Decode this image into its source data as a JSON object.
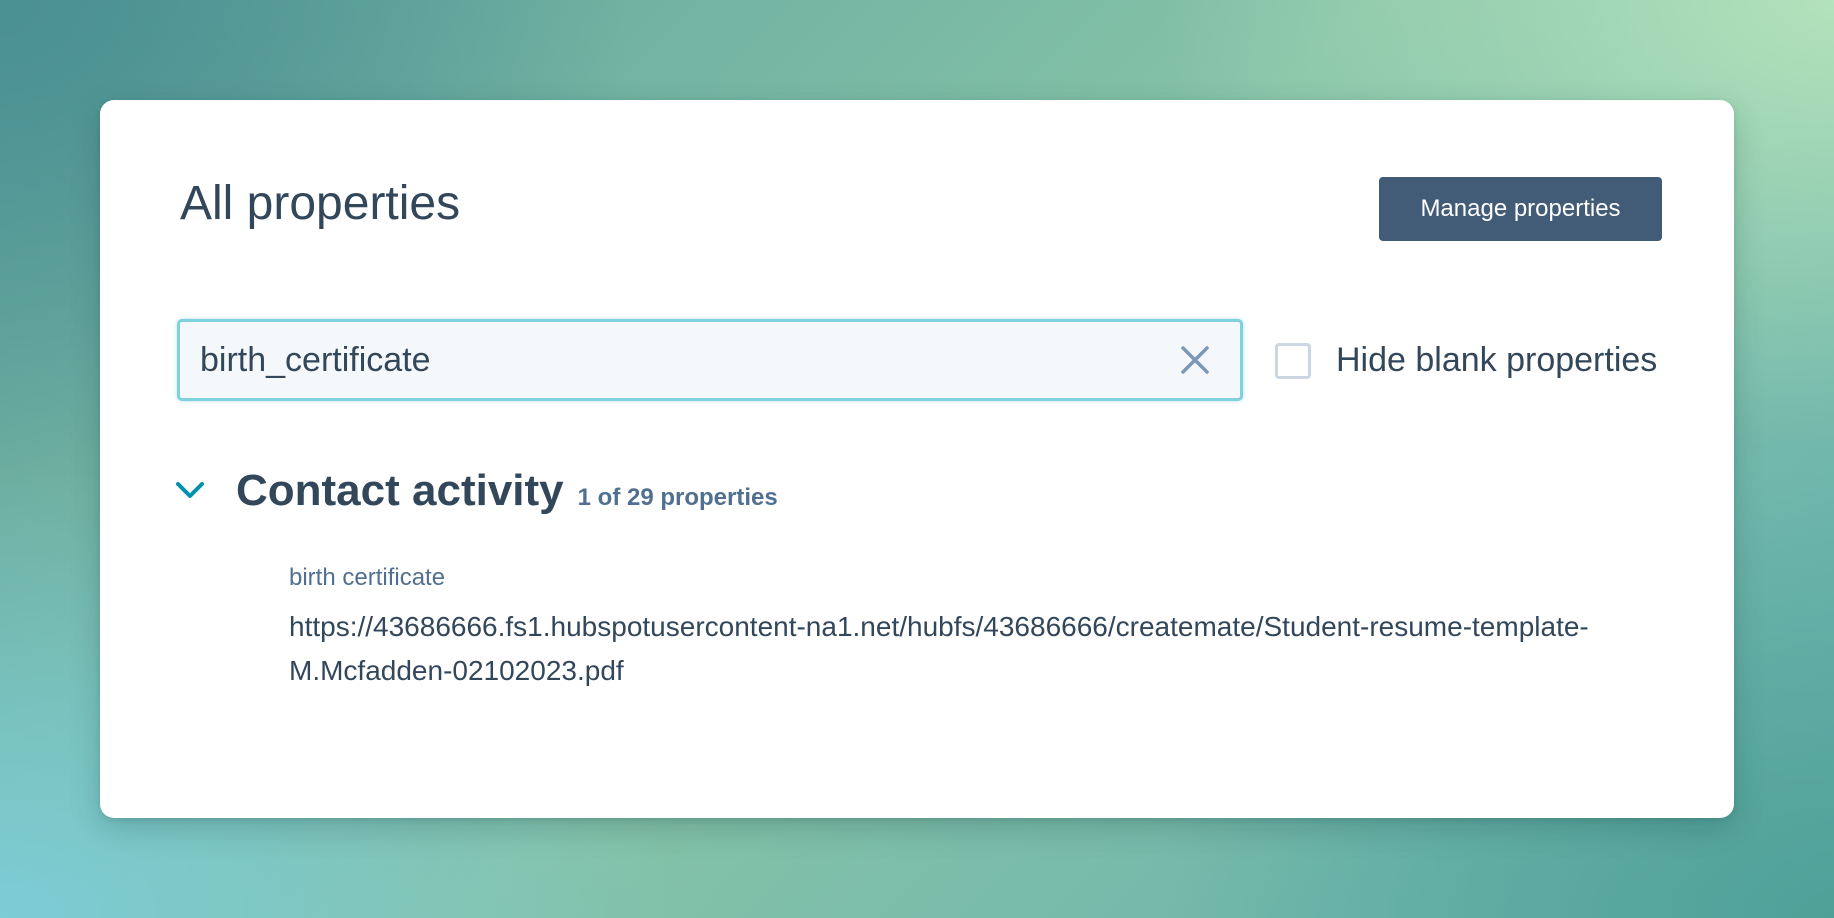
{
  "page": {
    "title": "All properties",
    "manage_button_label": "Manage properties"
  },
  "search": {
    "value": "birth_certificate",
    "placeholder": "",
    "clear_icon": "close-icon"
  },
  "filter": {
    "hide_blank_label": "Hide blank properties",
    "hide_blank_checked": false
  },
  "sections": [
    {
      "title": "Contact activity",
      "count_label": "1 of 29 properties",
      "expanded": true,
      "chevron_icon": "chevron-down-icon",
      "properties": [
        {
          "label": "birth certificate",
          "value": "https://43686666.fs1.hubspotusercontent-na1.net/hubfs/43686666/createmate/Student-resume-template-M.Mcfadden-02102023.pdf"
        }
      ]
    }
  ],
  "colors": {
    "text_primary": "#33475b",
    "text_secondary": "#516f90",
    "button_bg": "#425b76",
    "focus_border": "#7fd1de",
    "chevron": "#0091ae"
  }
}
